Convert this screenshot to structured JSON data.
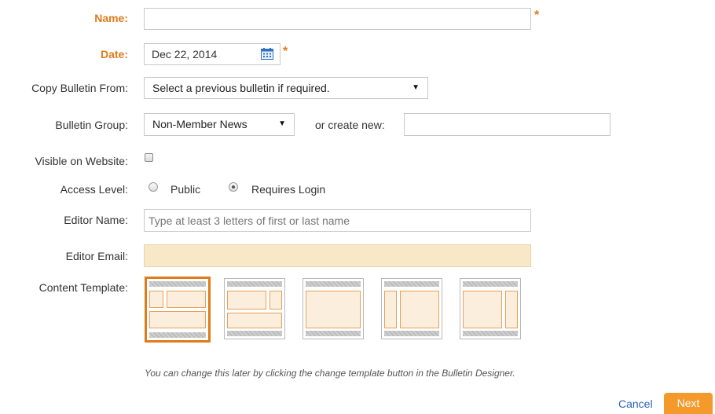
{
  "form": {
    "name": {
      "label": "Name:",
      "value": "",
      "required_mark": "*"
    },
    "date": {
      "label": "Date:",
      "value": "Dec 22, 2014",
      "required_mark": "*"
    },
    "copy_from": {
      "label": "Copy Bulletin From:",
      "selected": "Select a previous bulletin if required."
    },
    "group": {
      "label": "Bulletin Group:",
      "selected": "Non-Member News",
      "or_create": "or create new:",
      "new_value": ""
    },
    "visible": {
      "label": "Visible on Website:",
      "checked": false
    },
    "access": {
      "label": "Access Level:",
      "options": [
        "Public",
        "Requires Login"
      ],
      "selected": "Requires Login"
    },
    "editor_name": {
      "label": "Editor Name:",
      "placeholder": "Type at least 3 letters of first or last name"
    },
    "editor_email": {
      "label": "Editor Email:",
      "value": ""
    },
    "template": {
      "label": "Content Template:",
      "selected_index": 0
    }
  },
  "hint": "You can change this later by clicking the change template button in the Bulletin Designer.",
  "actions": {
    "cancel": "Cancel",
    "next": "Next"
  },
  "colors": {
    "accent": "#e07b1a",
    "button": "#f39a2b",
    "link": "#2a63b8",
    "email_bg": "#f9e8c8"
  },
  "icons": {
    "date": "calendar-icon",
    "dropdown": "triangle-down"
  }
}
